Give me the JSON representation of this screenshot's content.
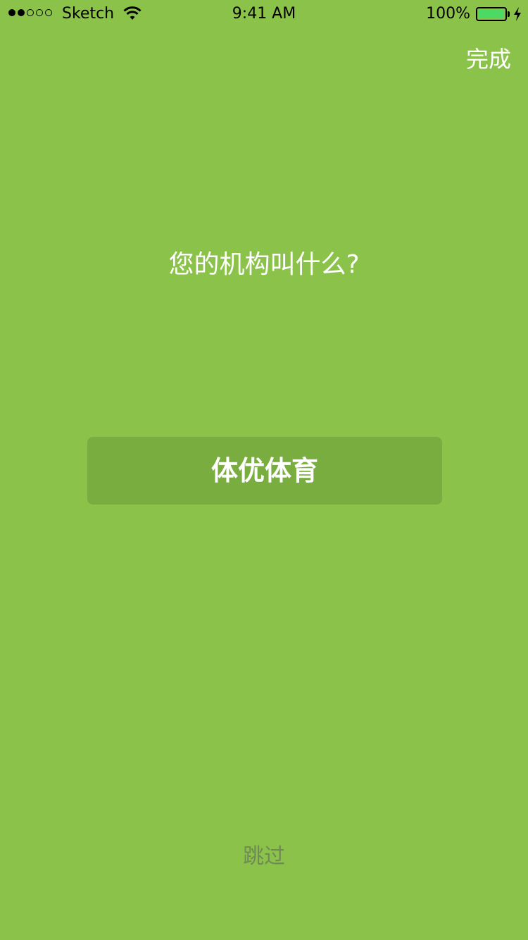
{
  "status_bar": {
    "carrier": "Sketch",
    "time": "9:41 AM",
    "battery_percent": "100%",
    "battery_level": 1.0,
    "signal_bars_filled": 2,
    "signal_bars_total": 5
  },
  "header": {
    "done_label": "完成"
  },
  "main": {
    "question": "您的机构叫什么?",
    "org_name_value": "体优体育"
  },
  "footer": {
    "skip_label": "跳过"
  },
  "colors": {
    "background": "#8bc34a",
    "input_background": "#7aad40",
    "skip_text": "#6f8a55",
    "battery_fill": "#4cd964"
  }
}
